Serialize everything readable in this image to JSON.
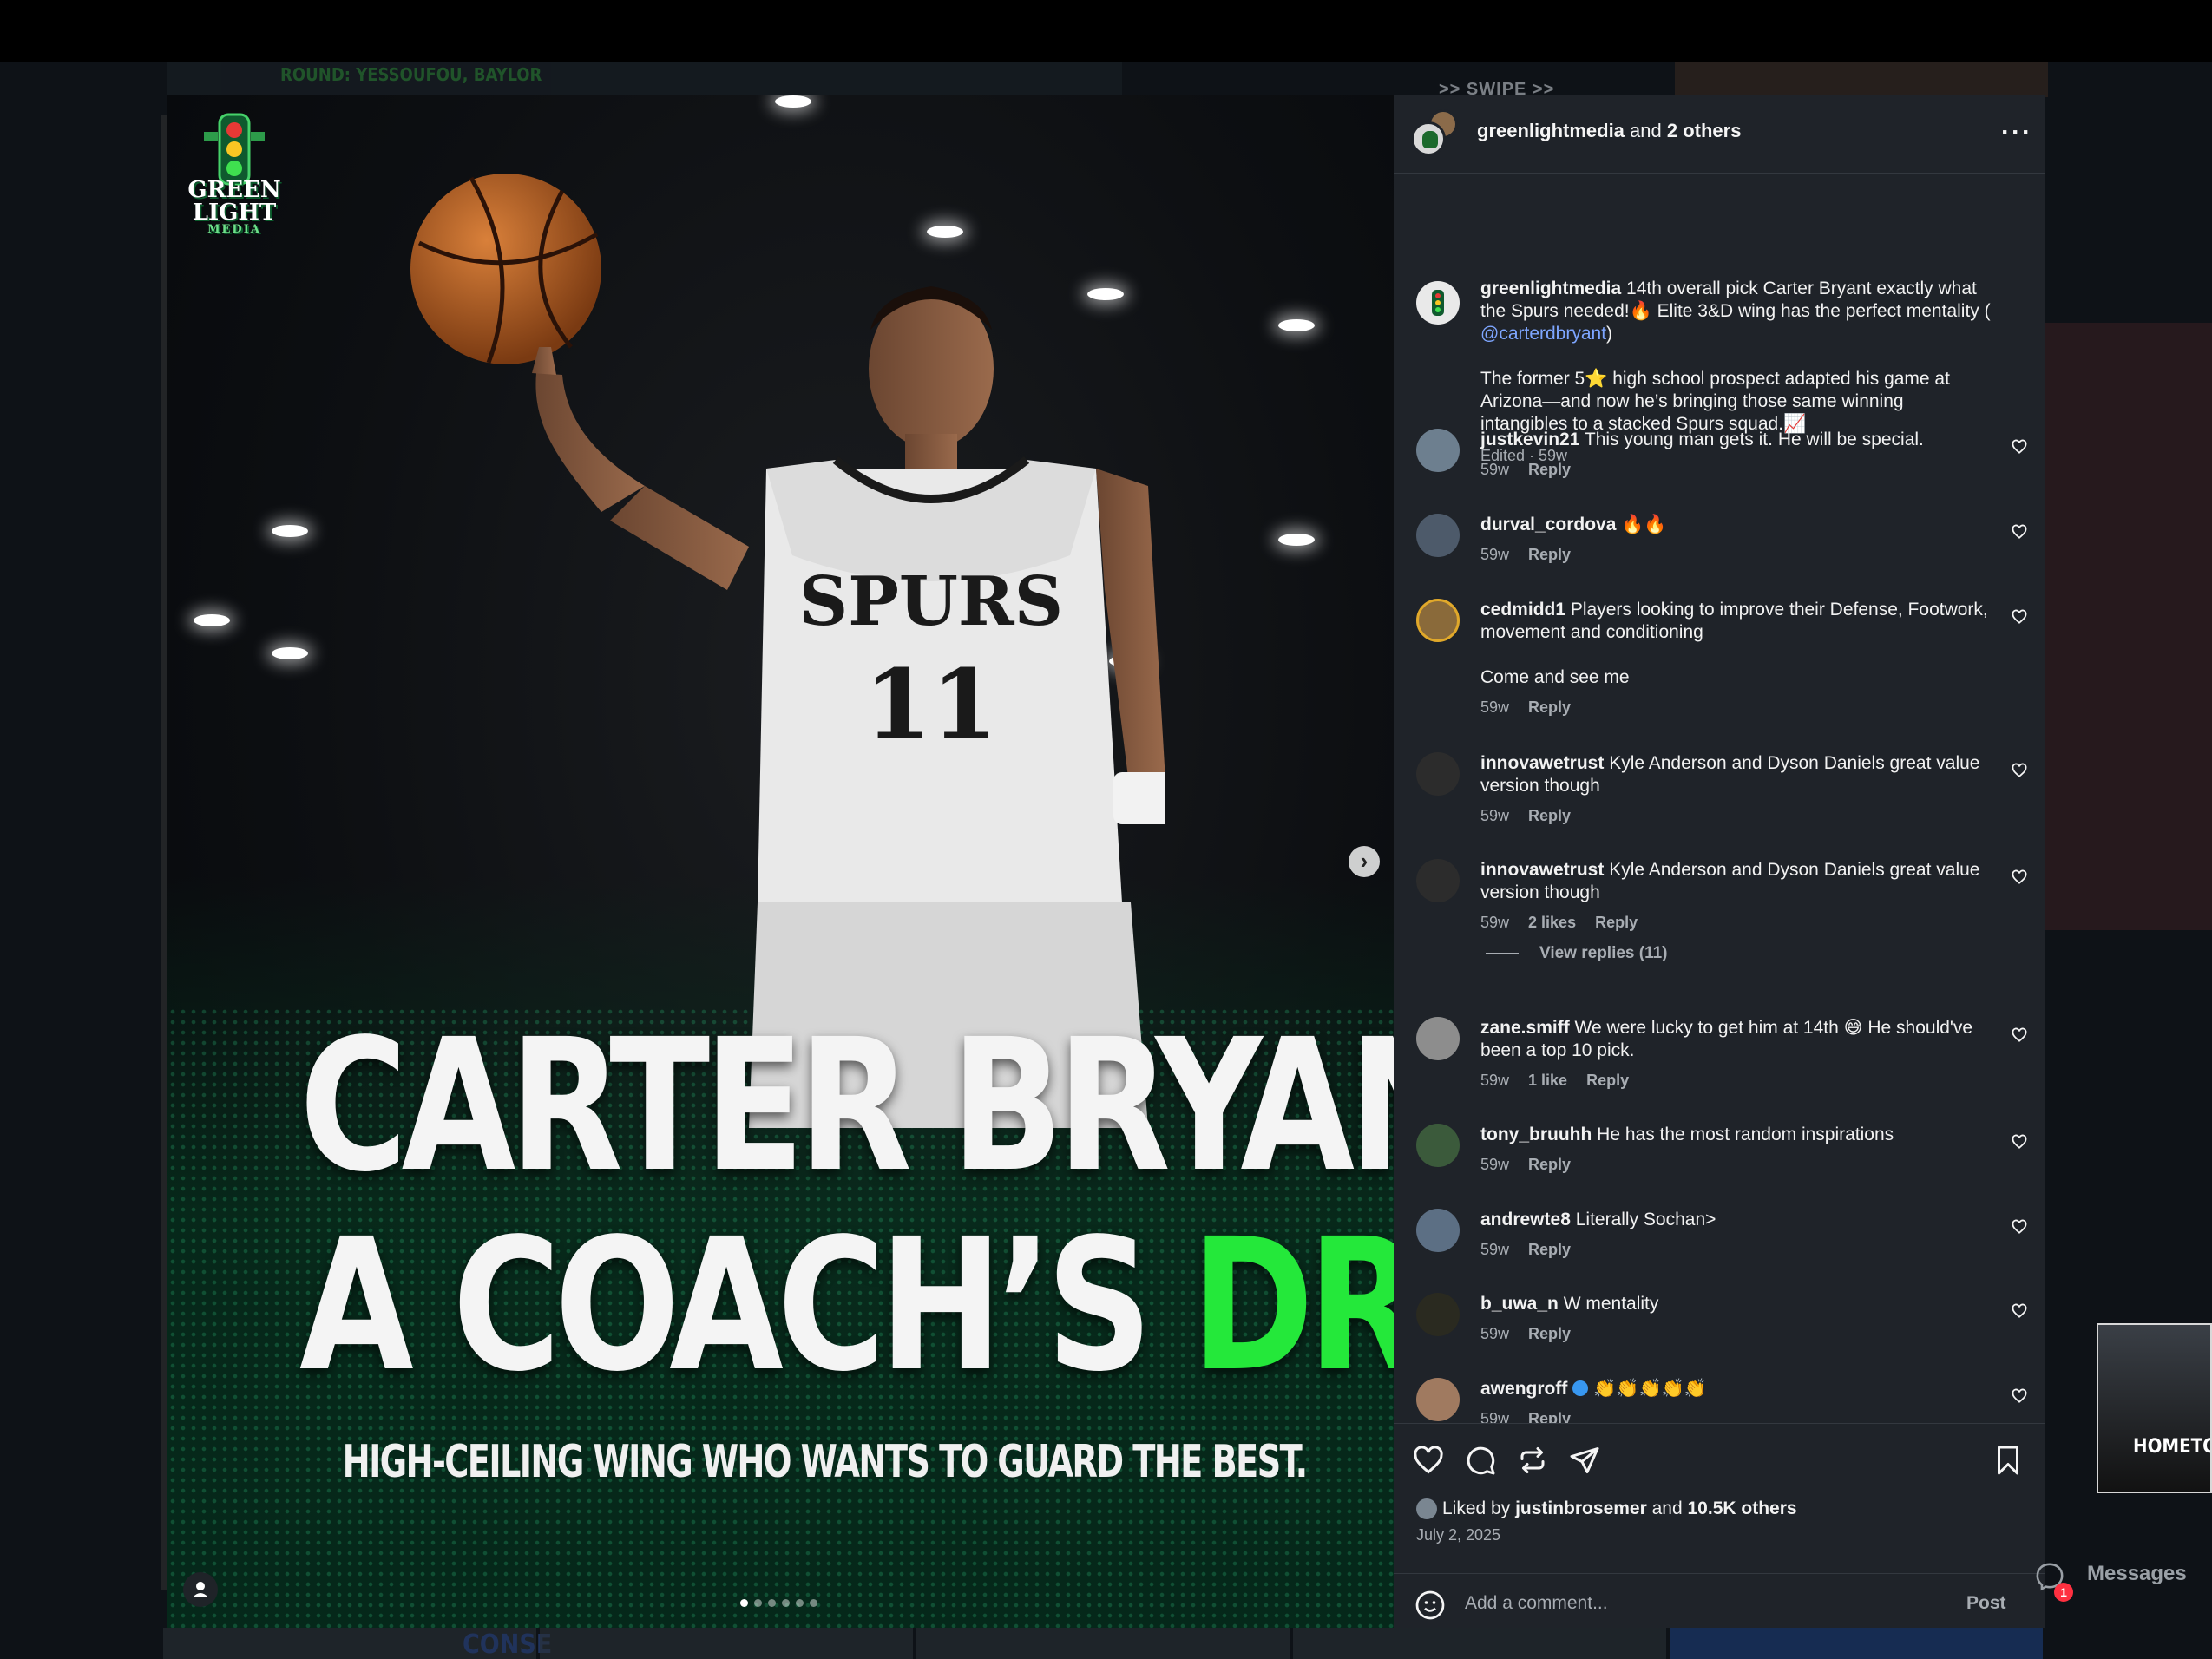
{
  "background": {
    "feed_text_1": "ROUND: YESSOUFOU, BAYLOR",
    "swipe_hint": ">> SWIPE >>",
    "strip_text": "CONSE",
    "mini_thumb_text": "HOMETOWN"
  },
  "post": {
    "logo": {
      "name": "GREEN LIGHT",
      "sub": "MEDIA"
    },
    "headline_line1": "CARTER BRYANT IS",
    "headline_line2_prefix": "A COACH’S",
    "headline_line2_highlight": "DREAM",
    "subline": "HIGH-CEILING WING WHO WANTS TO GUARD THE BEST.",
    "jersey_team": "SPURS",
    "jersey_number": "11",
    "carousel": {
      "count": 6,
      "active": 1
    }
  },
  "header": {
    "username": "greenlightmedia",
    "joiner": " and ",
    "others": "2 others",
    "more": "···"
  },
  "caption": {
    "username": "greenlightmedia",
    "text_1": " 14th overall pick Carter Bryant exactly what the Spurs needed!🔥 Elite 3&D wing has the perfect mentality ( ",
    "mention": "@carterdbryant",
    "text_1_end": ")",
    "text_2": "The former 5⭐ high school prospect adapted his game at Arizona—and now he’s bringing those same winning intangibles to a stacked Spurs squad.📈",
    "edited": "Edited · 59w"
  },
  "comments": [
    {
      "user": "justkevin21",
      "text": "This young man gets it. He will be special.",
      "time": "59w",
      "likes": "",
      "reply": "Reply"
    },
    {
      "user": "durval_cordova",
      "text": "🔥🔥",
      "time": "59w",
      "likes": "",
      "reply": "Reply"
    },
    {
      "user": "cedmidd1",
      "text": "Players looking to improve their Defense, Footwork, movement and conditioning",
      "text2": "Come and see me",
      "time": "59w",
      "likes": "",
      "reply": "Reply"
    },
    {
      "user": "innovawetrust",
      "text": "Kyle Anderson and Dyson Daniels great value version though",
      "time": "59w",
      "likes": "",
      "reply": "Reply"
    },
    {
      "user": "innovawetrust",
      "text": "Kyle Anderson and Dyson Daniels great value version though",
      "time": "59w",
      "likes": "2 likes",
      "reply": "Reply",
      "view_replies": "View replies (11)"
    },
    {
      "user": "zane.smiff",
      "text": "We were lucky to get him at 14th 😅 He should've been a top 10 pick.",
      "time": "59w",
      "likes": "1 like",
      "reply": "Reply"
    },
    {
      "user": "tony_bruuhh",
      "text": "He has the most random inspirations",
      "time": "59w",
      "likes": "",
      "reply": "Reply"
    },
    {
      "user": "andrewte8",
      "text": "Literally Sochan>",
      "time": "59w",
      "likes": "",
      "reply": "Reply"
    },
    {
      "user": "b_uwa_n",
      "text": "W mentality",
      "time": "59w",
      "likes": "",
      "reply": "Reply"
    },
    {
      "user": "awengroff",
      "text": "👏👏👏👏👏",
      "time": "59w",
      "likes": "",
      "reply": "Reply",
      "verified": true
    }
  ],
  "footer": {
    "liked_prefix": "Liked by ",
    "liked_user": "justinbrosemer",
    "liked_joiner": " and ",
    "liked_count": "10.5K others",
    "date": "July 2, 2025",
    "comment_placeholder": "Add a comment...",
    "post_label": "Post"
  },
  "messages": {
    "label": "Messages",
    "badge": "1"
  },
  "colors": {
    "accent_green": "#24e83a",
    "panel": "#1f2329",
    "link": "#7ea6ff"
  }
}
